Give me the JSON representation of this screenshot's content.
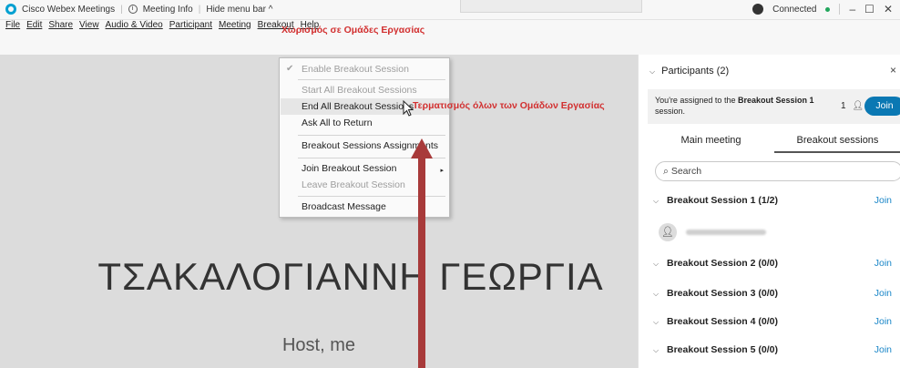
{
  "titlebar": {
    "app_name": "Cisco Webex Meetings",
    "meeting_info": "Meeting Info",
    "hide_menu": "Hide menu bar ^",
    "status": "Connected",
    "min": "–",
    "max": "☐",
    "close": "✕"
  },
  "menubar": {
    "items": [
      "File",
      "Edit",
      "Share",
      "View",
      "Audio & Video",
      "Participant",
      "Meeting",
      "Breakout",
      "Help"
    ]
  },
  "annotations": {
    "top": "Χωρισμός σε Ομάδες Εργασίας",
    "mid": "Τερματισμός όλων των Ομάδων Εργασίας"
  },
  "dropdown": {
    "items": [
      {
        "label": "Enable Breakout Session",
        "disabled": true,
        "checked": true
      },
      {
        "label": "Start All Breakout Sessions",
        "disabled": true
      },
      {
        "label": "End All Breakout Sessions",
        "disabled": false
      },
      {
        "label": "Ask All to Return",
        "disabled": false
      },
      {
        "label": "Breakout Sessions Assignments",
        "disabled": false
      },
      {
        "label": "Join Breakout Session",
        "disabled": false
      },
      {
        "label": "Leave Breakout Session",
        "disabled": true
      },
      {
        "label": "Broadcast Message",
        "disabled": false
      }
    ],
    "check": "✔",
    "submenu_arrow": "▸"
  },
  "stage": {
    "name": "ΤΣΑΚΑΛΟΓΙΑΝΝΗ ΓΕΩΡΓΙΑ",
    "role": "Host, me"
  },
  "panel": {
    "header": "Participants (2)",
    "close": "×",
    "assign_text_prefix": "You're assigned to the ",
    "assign_session": "Breakout Session 1",
    "assign_text_suffix": " session.",
    "assign_count": "1",
    "join_button": "Join",
    "tabs": [
      "Main meeting",
      "Breakout sessions"
    ],
    "search_placeholder": "Search",
    "sessions": [
      {
        "name": "Breakout Session 1 (1/2)",
        "join": "Join"
      },
      {
        "name": "Breakout Session 2 (0/0)",
        "join": "Join"
      },
      {
        "name": "Breakout Session 3 (0/0)",
        "join": "Join"
      },
      {
        "name": "Breakout Session 4 (0/0)",
        "join": "Join"
      },
      {
        "name": "Breakout Session 5 (0/0)",
        "join": "Join"
      }
    ]
  },
  "colors": {
    "accent": "#0a78b3",
    "annotation": "#d23030",
    "arrow": "#a83a3a"
  }
}
